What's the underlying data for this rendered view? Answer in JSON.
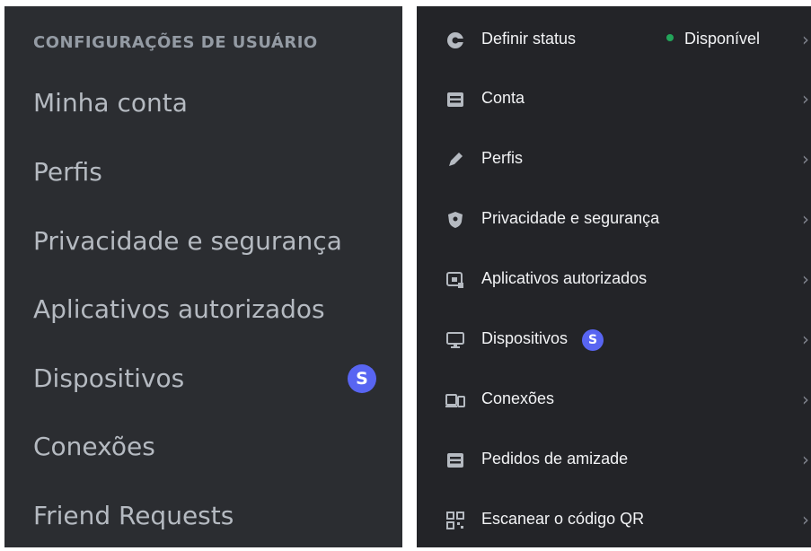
{
  "left_panel": {
    "header": "CONFIGURAÇÕES DE USUÁRIO",
    "items": [
      {
        "label": "Minha conta"
      },
      {
        "label": "Perfis"
      },
      {
        "label": "Privacidade e segurança"
      },
      {
        "label": "Aplicativos autorizados"
      },
      {
        "label": "Dispositivos",
        "badge": "S"
      },
      {
        "label": "Conexões"
      },
      {
        "label": "Friend Requests"
      }
    ]
  },
  "right_panel": {
    "items": [
      {
        "icon": "status-icon",
        "label": "Definir status",
        "status_text": "Disponível"
      },
      {
        "icon": "account-card-icon",
        "label": "Conta"
      },
      {
        "icon": "pencil-icon",
        "label": "Perfis"
      },
      {
        "icon": "shield-icon",
        "label": "Privacidade e segurança"
      },
      {
        "icon": "authorized-apps-icon",
        "label": "Aplicativos autorizados"
      },
      {
        "icon": "monitor-icon",
        "label": "Dispositivos",
        "badge": "S"
      },
      {
        "icon": "connections-icon",
        "label": "Conexões"
      },
      {
        "icon": "friend-requests-icon",
        "label": "Pedidos de amizade"
      },
      {
        "icon": "qr-code-icon",
        "label": "Escanear o código QR"
      }
    ],
    "chevron": "›"
  },
  "colors": {
    "left_bg": "#2b2d31",
    "right_bg": "#232428",
    "badge": "#5865f2",
    "online": "#23a55a",
    "muted_text": "#b5bac1",
    "header_text": "#949ba4"
  }
}
